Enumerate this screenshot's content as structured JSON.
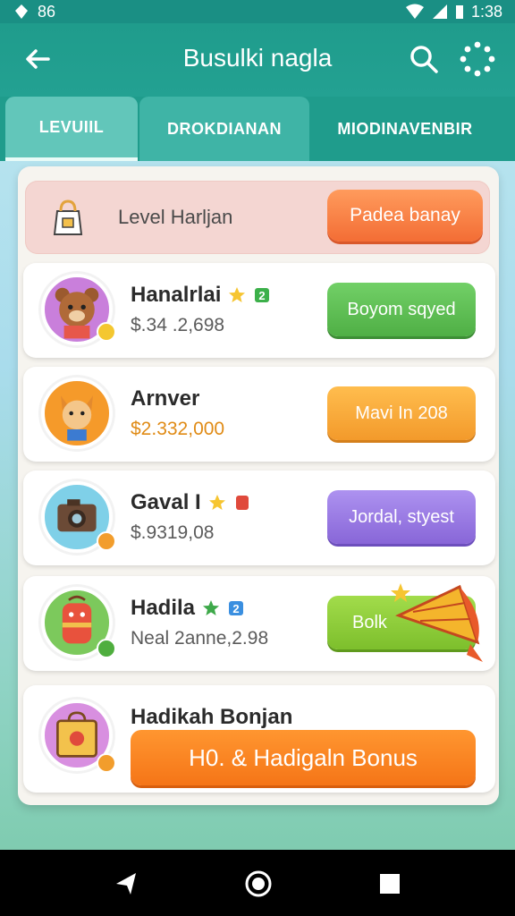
{
  "status": {
    "time": "1:38",
    "left_text": "86"
  },
  "appbar": {
    "title": "Busulki nagla"
  },
  "tabs": [
    {
      "label": "LEVUIIL"
    },
    {
      "label": "DROKDIANAN"
    },
    {
      "label": "MIODINAVENBIR"
    }
  ],
  "level": {
    "label": "Level Harljan",
    "button": "Padea banay"
  },
  "rows": [
    {
      "name": "Hanalrlai",
      "value": "$.34 .2,698",
      "button": "Boyom sqyed",
      "button_color": "#5fc255"
    },
    {
      "name": "Arnver",
      "value": "$2.332,000",
      "button": "Mavi In 208",
      "button_color": "#f7a43a"
    },
    {
      "name": "Gaval I",
      "value": "$.9319,08",
      "button": "Jordal, styest",
      "button_color": "#9a7be0"
    },
    {
      "name": "Hadila",
      "value": "Neal 2anne,2.98",
      "button": "Bolk",
      "button_color": "#8ccb3a"
    },
    {
      "name": "Hadikah Bonjan"
    }
  ],
  "bonus": {
    "button": "H0. & Hadigaln Bonus"
  },
  "badges": {
    "row1": "2",
    "row4": "2"
  }
}
